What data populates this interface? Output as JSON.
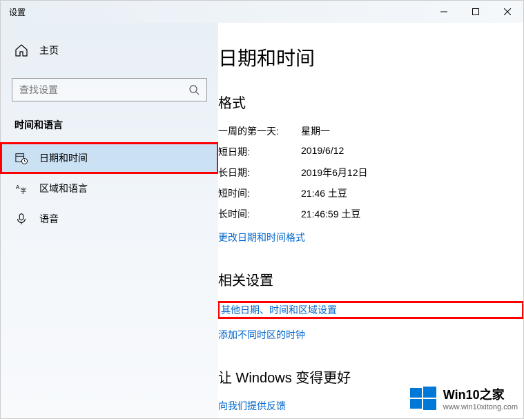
{
  "window": {
    "title": "设置"
  },
  "sidebar": {
    "home_label": "主页",
    "search_placeholder": "查找设置",
    "category": "时间和语言",
    "items": [
      {
        "label": "日期和时间"
      },
      {
        "label": "区域和语言"
      },
      {
        "label": "语音"
      }
    ]
  },
  "main": {
    "title": "日期和时间",
    "format": {
      "heading": "格式",
      "rows": [
        {
          "label": "一周的第一天:",
          "value": "星期一"
        },
        {
          "label": "短日期:",
          "value": "2019/6/12"
        },
        {
          "label": "长日期:",
          "value": "2019年6月12日"
        },
        {
          "label": "短时间:",
          "value": "21:46 土豆"
        },
        {
          "label": "长时间:",
          "value": "21:46:59 土豆"
        }
      ],
      "change_link": "更改日期和时间格式"
    },
    "related": {
      "heading": "相关设置",
      "other_link": "其他日期、时间和区域设置",
      "add_link": "添加不同时区的时钟"
    },
    "feedback": {
      "heading": "让 Windows 变得更好",
      "link": "向我们提供反馈"
    }
  },
  "watermark": {
    "brand": "Win10之家",
    "url": "www.win10xitong.com"
  }
}
